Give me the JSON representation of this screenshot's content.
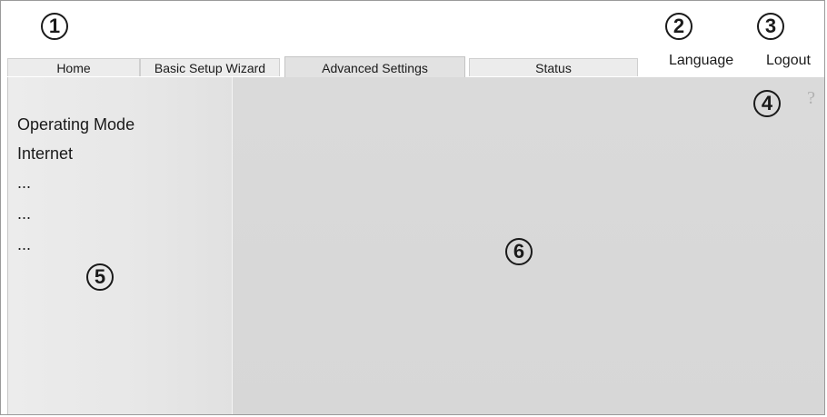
{
  "callouts": {
    "c1": "1",
    "c2": "2",
    "c3": "3",
    "c4": "4",
    "c5": "5",
    "c6": "6"
  },
  "tabs": [
    {
      "label": "Home"
    },
    {
      "label": "Basic Setup Wizard"
    },
    {
      "label": "Advanced Settings",
      "active": true
    },
    {
      "label": "Status"
    }
  ],
  "header": {
    "language": "Language",
    "logout": "Logout"
  },
  "sidebar": {
    "items": [
      {
        "label": "Operating Mode"
      },
      {
        "label": "Internet"
      },
      {
        "label": "..."
      },
      {
        "label": "..."
      },
      {
        "label": "..."
      }
    ]
  },
  "help": {
    "label": "?"
  }
}
